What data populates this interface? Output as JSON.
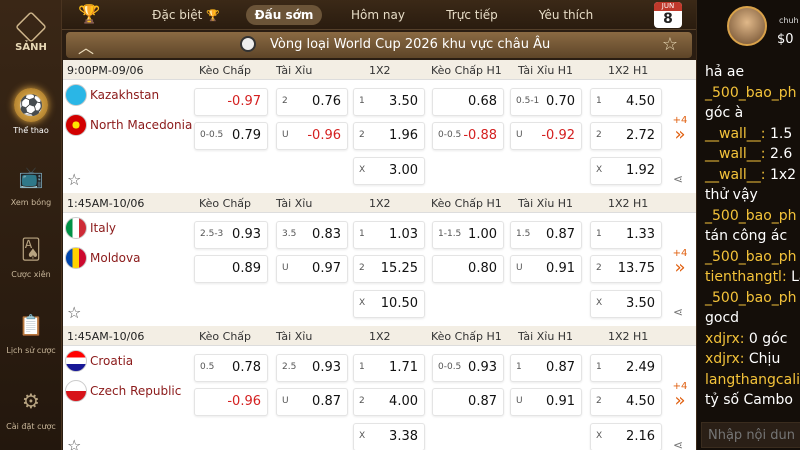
{
  "sidebar": {
    "logo": "SẢNH",
    "items": [
      {
        "label": "Thể thao",
        "icon": "football-icon"
      },
      {
        "label": "Xem bóng",
        "icon": "tv-icon"
      },
      {
        "label": "Cược xiên",
        "icon": "cards-icon"
      },
      {
        "label": "Lịch sử cược",
        "icon": "history-icon"
      },
      {
        "label": "Cài đặt cược",
        "icon": "gear-icon"
      }
    ]
  },
  "topnav": {
    "tabs": [
      "Đặc biệt",
      "Đấu sớm",
      "Hôm nay",
      "Trực tiếp",
      "Yêu thích"
    ],
    "active": "Đấu sớm",
    "calendar_month": "JUN",
    "calendar_day": "8"
  },
  "league": {
    "title": "Vòng loại World Cup 2026 khu vực châu Âu"
  },
  "columns": [
    "Kèo Chấp",
    "Tài Xỉu",
    "1X2",
    "Kèo Chấp H1",
    "Tài Xỉu H1",
    "1X2 H1"
  ],
  "matches": [
    {
      "time": "9:00PM-09/06",
      "home": "Kazakhstan",
      "away": "North Macedonia",
      "more": "+4",
      "row1": [
        {
          "l": "",
          "v": "-0.97"
        },
        {
          "l": "2",
          "v": "0.76"
        },
        {
          "l": "1",
          "v": "3.50"
        },
        {
          "l": "",
          "v": "0.68"
        },
        {
          "l": "0.5-1",
          "v": "0.70"
        },
        {
          "l": "1",
          "v": "4.50"
        }
      ],
      "row2": [
        {
          "l": "0-0.5",
          "v": "0.79"
        },
        {
          "l": "U",
          "v": "-0.96"
        },
        {
          "l": "2",
          "v": "1.96"
        },
        {
          "l": "0-0.5",
          "v": "-0.88"
        },
        {
          "l": "U",
          "v": "-0.92"
        },
        {
          "l": "2",
          "v": "2.72"
        }
      ],
      "draw": [
        {
          "l": "X",
          "v": "3.00"
        },
        {
          "l": "X",
          "v": "1.92"
        }
      ]
    },
    {
      "time": "1:45AM-10/06",
      "home": "Italy",
      "away": "Moldova",
      "more": "+4",
      "row1": [
        {
          "l": "2.5-3",
          "v": "0.93"
        },
        {
          "l": "3.5",
          "v": "0.83"
        },
        {
          "l": "1",
          "v": "1.03"
        },
        {
          "l": "1-1.5",
          "v": "1.00"
        },
        {
          "l": "1.5",
          "v": "0.87"
        },
        {
          "l": "1",
          "v": "1.33"
        }
      ],
      "row2": [
        {
          "l": "",
          "v": "0.89"
        },
        {
          "l": "U",
          "v": "0.97"
        },
        {
          "l": "2",
          "v": "15.25"
        },
        {
          "l": "",
          "v": "0.80"
        },
        {
          "l": "U",
          "v": "0.91"
        },
        {
          "l": "2",
          "v": "13.75"
        }
      ],
      "draw": [
        {
          "l": "X",
          "v": "10.50"
        },
        {
          "l": "X",
          "v": "3.50"
        }
      ]
    },
    {
      "time": "1:45AM-10/06",
      "home": "Croatia",
      "away": "Czech Republic",
      "more": "+4",
      "row1": [
        {
          "l": "0.5",
          "v": "0.78"
        },
        {
          "l": "2.5",
          "v": "0.93"
        },
        {
          "l": "1",
          "v": "1.71"
        },
        {
          "l": "0-0.5",
          "v": "0.93"
        },
        {
          "l": "1",
          "v": "0.87"
        },
        {
          "l": "1",
          "v": "2.49"
        }
      ],
      "row2": [
        {
          "l": "",
          "v": "-0.96"
        },
        {
          "l": "U",
          "v": "0.87"
        },
        {
          "l": "2",
          "v": "4.00"
        },
        {
          "l": "",
          "v": "0.87"
        },
        {
          "l": "U",
          "v": "0.91"
        },
        {
          "l": "2",
          "v": "4.50"
        }
      ],
      "draw": [
        {
          "l": "X",
          "v": "3.38"
        },
        {
          "l": "X",
          "v": "2.16"
        }
      ]
    }
  ],
  "chat": {
    "username": "chuh",
    "balance": "$0",
    "messages": [
      {
        "u": "",
        "t": "hả ae"
      },
      {
        "u": "_500_bao_ph",
        "t": ""
      },
      {
        "u": "",
        "t": "góc à"
      },
      {
        "u": "__wall__:",
        "t": " 1.5"
      },
      {
        "u": "__wall__:",
        "t": " 2.6"
      },
      {
        "u": "__wall__:",
        "t": " 1x2"
      },
      {
        "u": "",
        "t": "thử vậy"
      },
      {
        "u": "_500_bao_ph",
        "t": ""
      },
      {
        "u": "",
        "t": "tán công ác"
      },
      {
        "u": "_500_bao_ph",
        "t": ""
      },
      {
        "u": "tienthangtl:",
        "t": " La"
      },
      {
        "u": "_500_bao_ph",
        "t": ""
      },
      {
        "u": "",
        "t": "gocd"
      },
      {
        "u": "xdjrx:",
        "t": " 0 góc"
      },
      {
        "u": "xdjrx:",
        "t": " Chịu"
      },
      {
        "u": "langthangcalit",
        "t": ""
      },
      {
        "u": "",
        "t": "tỷ số Cambo"
      }
    ],
    "input_placeholder": "Nhập nội dun"
  }
}
